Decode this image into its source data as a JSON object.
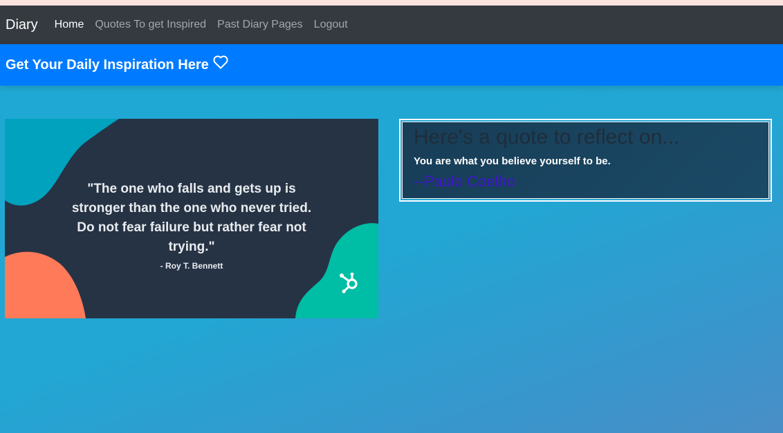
{
  "navbar": {
    "brand": "Diary",
    "links": [
      {
        "label": "Home"
      },
      {
        "label": "Quotes To get Inspired"
      },
      {
        "label": "Past Diary Pages"
      },
      {
        "label": "Logout"
      }
    ]
  },
  "banner": {
    "title": "Get Your Daily Inspiration Here",
    "icon": "heart-outline-icon"
  },
  "image_card": {
    "quote": "\"The one who falls and gets up is stronger than the one who never tried. Do not fear failure but rather fear not trying.\"",
    "author": "- Roy T. Bennett",
    "logo_icon": "hubspot-sprocket-icon"
  },
  "quote_card": {
    "heading": "Here's a quote to reflect on...",
    "text": "You are what you believe yourself to be.",
    "author": "--Paulo Coelho"
  },
  "colors": {
    "navbar_bg": "#343a40",
    "banner_bg": "#007bff",
    "page_bg": "#22a6d3",
    "author_color": "#3f14c7",
    "image_bg": "#263345",
    "blob_teal": "#00a2be",
    "blob_green": "#00bda5",
    "blob_coral": "#ff7a59"
  }
}
